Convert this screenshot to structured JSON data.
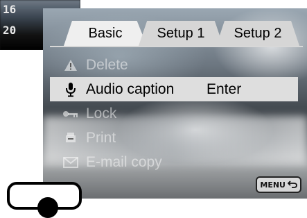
{
  "background_screen": {
    "line1": "16",
    "line2": "20"
  },
  "tabs": [
    {
      "label": "Basic",
      "active": true
    },
    {
      "label": "Setup 1",
      "active": false
    },
    {
      "label": "Setup 2",
      "active": false
    }
  ],
  "menu": {
    "items": [
      {
        "icon": "warning-icon",
        "label": "Delete",
        "value": "",
        "enabled": false
      },
      {
        "icon": "microphone-icon",
        "label": "Audio caption",
        "value": "Enter",
        "enabled": true,
        "selected": true
      },
      {
        "icon": "key-icon",
        "label": "Lock",
        "value": "",
        "enabled": false
      },
      {
        "icon": "print-icon",
        "label": "Print",
        "value": "",
        "enabled": false
      },
      {
        "icon": "email-icon",
        "label": "E-mail copy",
        "value": "",
        "enabled": false
      }
    ]
  },
  "menu_button": {
    "label": "MENU",
    "icon": "return-arrow-icon"
  }
}
